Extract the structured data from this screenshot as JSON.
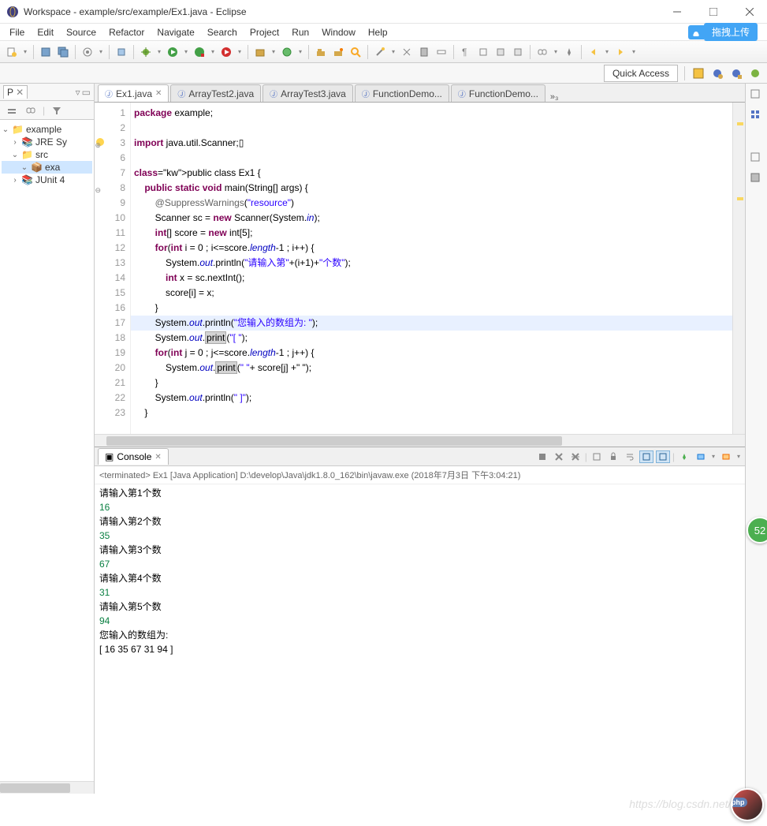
{
  "window": {
    "title": "Workspace - example/src/example/Ex1.java - Eclipse"
  },
  "menus": [
    "File",
    "Edit",
    "Source",
    "Refactor",
    "Navigate",
    "Search",
    "Project",
    "Run",
    "Window",
    "Help"
  ],
  "upload_label": "拖拽上传",
  "quick_access": "Quick Access",
  "package_explorer_tab": "P",
  "tree": {
    "root": "example",
    "jre": "JRE Sy",
    "src": "src",
    "pkg": "exa",
    "junit": "JUnit 4"
  },
  "editor_tabs": [
    {
      "label": "Ex1.java",
      "active": true,
      "closeable": true
    },
    {
      "label": "ArrayTest2.java",
      "active": false
    },
    {
      "label": "ArrayTest3.java",
      "active": false
    },
    {
      "label": "FunctionDemo...",
      "active": false
    },
    {
      "label": "FunctionDemo...",
      "active": false
    }
  ],
  "editor_more": "»₃",
  "code_lines": [
    {
      "n": 1,
      "t": "package",
      "r": " example;",
      "kw": true
    },
    {
      "n": 2,
      "t": "",
      "r": ""
    },
    {
      "n": 3,
      "mk": "warn",
      "fold": "⊕",
      "raw": "import java.util.Scanner;▯",
      "kw_import": true
    },
    {
      "n": 6,
      "t": "",
      "r": ""
    },
    {
      "n": 7,
      "raw": "public class Ex1 {",
      "kws": [
        "public",
        "class"
      ]
    },
    {
      "n": 8,
      "fold": "⊖",
      "raw": "    public static void main(String[] args) {",
      "kws": [
        "public",
        "static",
        "void"
      ]
    },
    {
      "n": 9,
      "raw": "        @SuppressWarnings(\"resource\")",
      "ann": true,
      "str": "\"resource\""
    },
    {
      "n": 10,
      "raw": "        Scanner sc = new Scanner(System.in);",
      "kws": [
        "new"
      ],
      "fld": "in"
    },
    {
      "n": 11,
      "raw": "        int[] score = new int[5];",
      "kws": [
        "int",
        "new",
        "int"
      ]
    },
    {
      "n": 12,
      "raw": "        for(int i = 0 ; i<=score.length-1 ; i++) {",
      "kws": [
        "for",
        "int"
      ],
      "fld": "length"
    },
    {
      "n": 13,
      "raw": "            System.out.println(\"请输入第\"+(i+1)+\"个数\");",
      "fld": "out",
      "str": [
        "\"请输入第\"",
        "\"个数\""
      ]
    },
    {
      "n": 14,
      "raw": "            int x = sc.nextInt();",
      "kws": [
        "int"
      ]
    },
    {
      "n": 15,
      "raw": "            score[i] = x;"
    },
    {
      "n": 16,
      "raw": "        }"
    },
    {
      "n": 17,
      "hl": true,
      "raw": "        System.out.println(\"您输入的数组为: \");",
      "fld": "out",
      "str": "\"您输入的数组为: \""
    },
    {
      "n": 18,
      "raw": "        System.out.print(\"[ \");",
      "fld": "out",
      "hlm": "print",
      "str": "\"[ \""
    },
    {
      "n": 19,
      "raw": "        for(int j = 0 ; j<=score.length-1 ; j++) {",
      "kws": [
        "for",
        "int"
      ],
      "fld": "length"
    },
    {
      "n": 20,
      "raw": "            System.out.print(\" \"+ score[j] +\" \");",
      "fld": "out",
      "hlm": "print",
      "str": [
        "\" \"",
        "\" \""
      ]
    },
    {
      "n": 21,
      "raw": "        }"
    },
    {
      "n": 22,
      "raw": "        System.out.println(\" ]\");",
      "fld": "out",
      "str": "\" ]\""
    },
    {
      "n": 23,
      "raw": "    }"
    }
  ],
  "console": {
    "tab": "Console",
    "header": "<terminated> Ex1 [Java Application] D:\\develop\\Java\\jdk1.8.0_162\\bin\\javaw.exe (2018年7月3日 下午3:04:21)",
    "lines": [
      {
        "t": "请输入第1个数"
      },
      {
        "t": "16",
        "inp": true
      },
      {
        "t": "请输入第2个数"
      },
      {
        "t": "35",
        "inp": true
      },
      {
        "t": "请输入第3个数"
      },
      {
        "t": "67",
        "inp": true
      },
      {
        "t": "请输入第4个数"
      },
      {
        "t": "31",
        "inp": true
      },
      {
        "t": "请输入第5个数"
      },
      {
        "t": "94",
        "inp": true
      },
      {
        "t": "您输入的数组为: "
      },
      {
        "t": "[  16  35  67  31  94  ]"
      }
    ]
  },
  "badge": "52",
  "watermark": "https://blog.csdn.net/an",
  "php_badge": "php"
}
